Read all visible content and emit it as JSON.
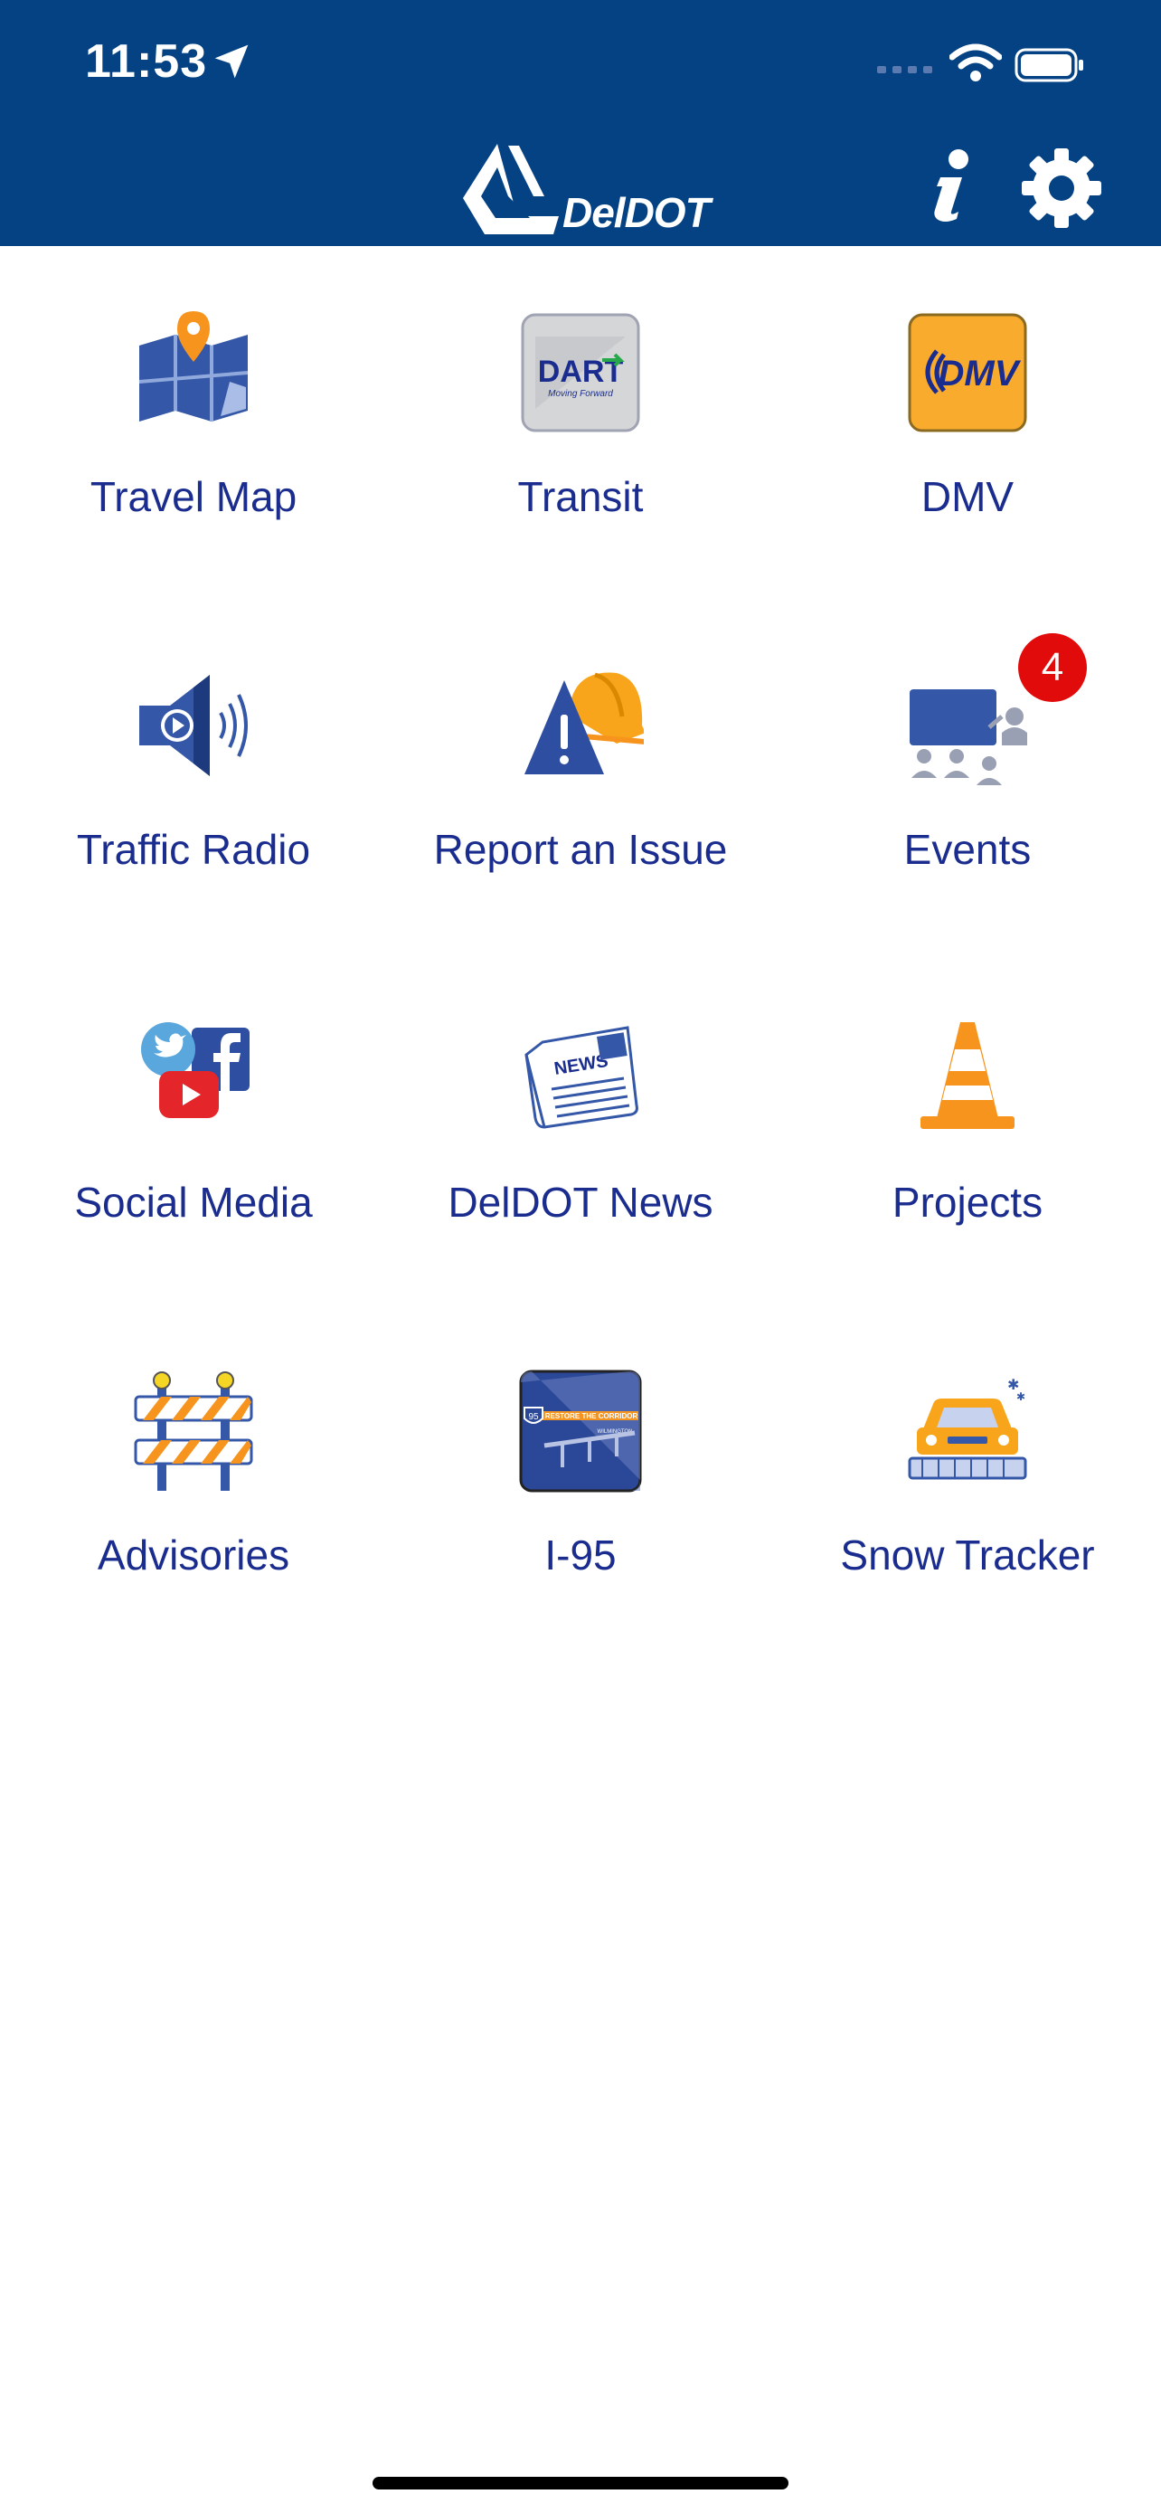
{
  "status_bar": {
    "time": "11:53"
  },
  "header": {
    "logo_text": "DelDOT"
  },
  "tiles": [
    {
      "label": "Travel Map"
    },
    {
      "label": "Transit",
      "icon_text": "DART",
      "icon_subtext": "Moving Forward"
    },
    {
      "label": "DMV",
      "icon_text": "DMV"
    },
    {
      "label": "Traffic Radio"
    },
    {
      "label": "Report an Issue"
    },
    {
      "label": "Events",
      "badge": "4"
    },
    {
      "label": "Social Media"
    },
    {
      "label": "DelDOT News",
      "icon_text": "NEWS"
    },
    {
      "label": "Projects"
    },
    {
      "label": "Advisories"
    },
    {
      "label": "I-95",
      "icon_text": "RESTORE THE CORRIDOR",
      "icon_subtext": "WILMINGTON",
      "shield": "95"
    },
    {
      "label": "Snow Tracker"
    }
  ],
  "colors": {
    "header_bg": "#044283",
    "label": "#1a2d8f",
    "badge": "#e10b0b"
  }
}
